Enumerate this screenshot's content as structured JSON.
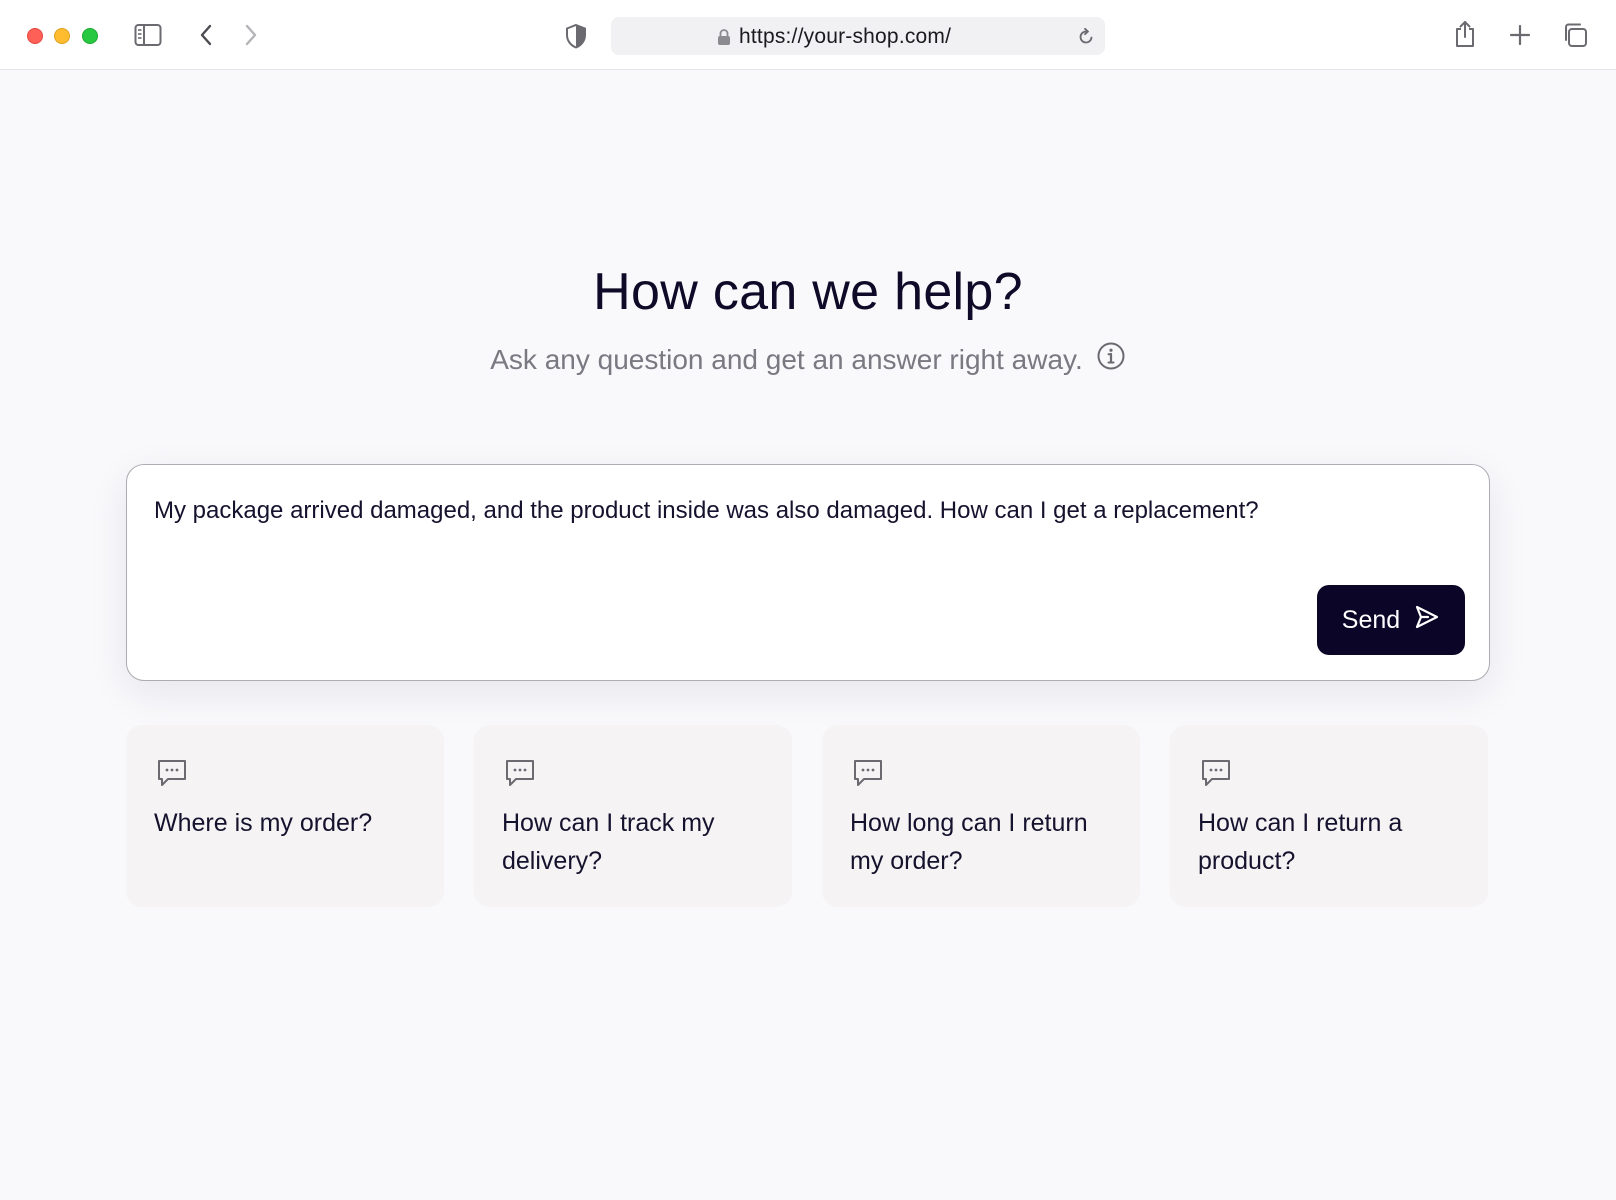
{
  "browser": {
    "url": "https://your-shop.com/"
  },
  "hero": {
    "title": "How can we help?",
    "subtitle": "Ask any question and get an answer right away."
  },
  "chat": {
    "message": "My package arrived damaged, and the product inside was also damaged. How can I get a replacement?",
    "send_label": "Send"
  },
  "suggestions": [
    {
      "label": "Where is my order?"
    },
    {
      "label": "How can I track my delivery?"
    },
    {
      "label": "How long can I return my order?"
    },
    {
      "label": "How can I return a product?"
    }
  ],
  "icons": {
    "window_controls": [
      "close-icon",
      "minimize-icon",
      "zoom-icon"
    ],
    "toolbar": [
      "sidebar-icon",
      "back-icon",
      "forward-icon",
      "shield-icon",
      "lock-icon",
      "reload-icon",
      "share-icon",
      "new-tab-icon",
      "tabs-icon"
    ],
    "info": "info-icon",
    "send": "send-icon",
    "suggestion": "chat-bubble-icon"
  },
  "colors": {
    "primary": "#0b0628",
    "background": "#f9f8fb",
    "card": "#f5f3f3"
  }
}
